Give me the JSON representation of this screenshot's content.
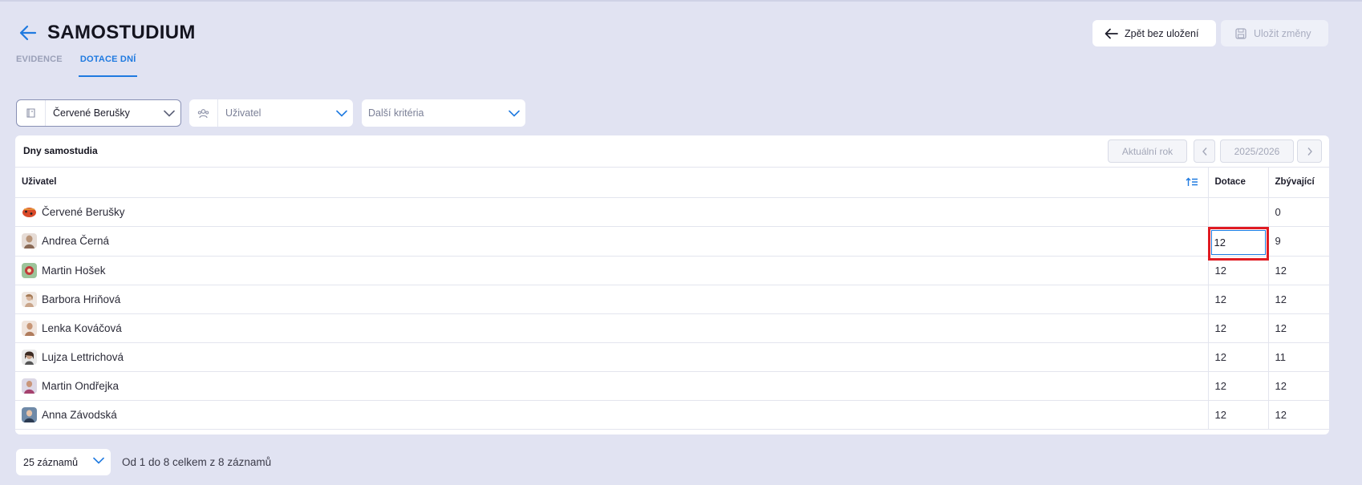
{
  "header": {
    "title": "SAMOSTUDIUM",
    "tabs": [
      {
        "label": "EVIDENCE",
        "active": false
      },
      {
        "label": "DOTACE DNÍ",
        "active": true
      }
    ],
    "back_without_save_label": "Zpět bez uložení",
    "save_changes_label": "Uložit změny"
  },
  "filters": {
    "group": {
      "value": "Červené Berušky"
    },
    "user": {
      "placeholder": "Uživatel"
    },
    "more": {
      "placeholder": "Další kritéria"
    }
  },
  "table": {
    "title": "Dny samostudia",
    "current_year_label": "Aktuální rok",
    "year": "2025/2026",
    "columns": {
      "user": "Uživatel",
      "dotace": "Dotace",
      "zbyvajici": "Zbývající"
    },
    "rows": [
      {
        "name": "Červené Berušky",
        "dotace": "",
        "zbyvajici": "0"
      },
      {
        "name": "Andrea Černá",
        "dotace": "12",
        "zbyvajici": "9",
        "editing": true
      },
      {
        "name": "Martin Hošek",
        "dotace": "12",
        "zbyvajici": "12"
      },
      {
        "name": "Barbora Hriňová",
        "dotace": "12",
        "zbyvajici": "12"
      },
      {
        "name": "Lenka Kováčová",
        "dotace": "12",
        "zbyvajici": "12"
      },
      {
        "name": "Lujza Lettrichová",
        "dotace": "12",
        "zbyvajici": "11"
      },
      {
        "name": "Martin Ondřejka",
        "dotace": "12",
        "zbyvajici": "12"
      },
      {
        "name": "Anna Závodská",
        "dotace": "12",
        "zbyvajici": "12"
      }
    ]
  },
  "footer": {
    "page_size": "25 záznamů",
    "records_info": "Od 1 do 8 celkem z 8 záznamů"
  },
  "colors": {
    "accent": "#1f7ae0",
    "background": "#e1e3f2",
    "highlight": "#e01b22"
  }
}
